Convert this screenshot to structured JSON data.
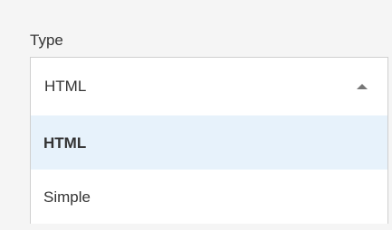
{
  "field": {
    "label": "Type"
  },
  "select": {
    "current_value": "HTML",
    "caret_icon": "chevron-up-icon",
    "options": [
      {
        "label": "HTML",
        "highlighted": true
      },
      {
        "label": "Simple",
        "highlighted": false
      }
    ]
  },
  "colors": {
    "highlight": "#e7f2fb",
    "border": "#cfcfcf",
    "text": "#333333"
  }
}
